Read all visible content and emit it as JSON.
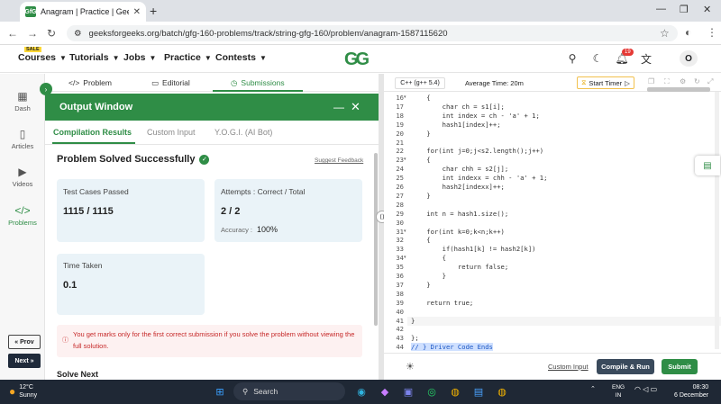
{
  "browser": {
    "tab_title": "Anagram | Practice | GeeksforG",
    "favicon": "GfG",
    "url": "geeksforgeeks.org/batch/gfg-160-problems/track/string-gfg-160/problem/anagram-1587115620"
  },
  "site_header": {
    "sale_badge": "SALE",
    "menus": [
      "Courses",
      "Tutorials",
      "Jobs",
      "Practice",
      "Contests"
    ],
    "logo": "GG",
    "notification_count": "19",
    "avatar_letter": "O"
  },
  "left_rail": {
    "items": [
      {
        "label": "Dash",
        "icon": "dashboard-icon"
      },
      {
        "label": "Articles",
        "icon": "articles-icon"
      },
      {
        "label": "Videos",
        "icon": "videos-icon"
      },
      {
        "label": "Problems",
        "icon": "code-icon"
      }
    ],
    "prev_label": "« Prov",
    "next_label": "Next »"
  },
  "problem_tabs": {
    "problem": "Problem",
    "editorial": "Editorial",
    "submissions": "Submissions"
  },
  "output_window": {
    "title": "Output Window",
    "tabs": [
      "Compilation Results",
      "Custom Input",
      "Y.O.G.I. (AI Bot)"
    ],
    "status": "Problem Solved Successfully",
    "suggest_feedback": "Suggest Feedback",
    "test_cases_label": "Test Cases Passed",
    "test_cases_value": "1115 / 1115",
    "attempts_label": "Attempts : Correct / Total",
    "attempts_value": "2 / 2",
    "accuracy_label": "Accuracy :",
    "accuracy_value": "100%",
    "time_label": "Time Taken",
    "time_value": "0.1",
    "warning": "You get marks only for the first correct submission if you solve the problem without viewing the full solution.",
    "solve_next": "Solve Next"
  },
  "editor": {
    "language": "C++ (g++ 5.4)",
    "average_time": "Average Time: 20m",
    "start_timer": "Start Timer",
    "lines": [
      {
        "n": "16",
        "fold": true,
        "text": "    {"
      },
      {
        "n": "17",
        "text": "        char ch = s1[i];"
      },
      {
        "n": "18",
        "text": "        int index = ch - 'a' + 1;"
      },
      {
        "n": "19",
        "text": "        hash1[index]++;"
      },
      {
        "n": "20",
        "text": "    }"
      },
      {
        "n": "21",
        "text": ""
      },
      {
        "n": "22",
        "text": "    for(int j=0;j<s2.length();j++)"
      },
      {
        "n": "23",
        "fold": true,
        "text": "    {"
      },
      {
        "n": "24",
        "text": "        char chh = s2[j];"
      },
      {
        "n": "25",
        "text": "        int indexx = chh - 'a' + 1;"
      },
      {
        "n": "26",
        "text": "        hash2[indexx]++;"
      },
      {
        "n": "27",
        "text": "    }"
      },
      {
        "n": "28",
        "text": ""
      },
      {
        "n": "29",
        "text": "    int n = hash1.size();"
      },
      {
        "n": "30",
        "text": ""
      },
      {
        "n": "31",
        "fold": true,
        "text": "    for(int k=0;k<n;k++)"
      },
      {
        "n": "32",
        "text": "    {"
      },
      {
        "n": "33",
        "text": "        if(hash1[k] != hash2[k])"
      },
      {
        "n": "34",
        "fold": true,
        "text": "        {"
      },
      {
        "n": "35",
        "text": "            return false;"
      },
      {
        "n": "36",
        "text": "        }"
      },
      {
        "n": "37",
        "text": "    }"
      },
      {
        "n": "38",
        "text": ""
      },
      {
        "n": "39",
        "text": "    return true;"
      },
      {
        "n": "40",
        "text": ""
      },
      {
        "n": "41",
        "text": "}"
      },
      {
        "n": "42",
        "text": ""
      },
      {
        "n": "43",
        "text": "};"
      },
      {
        "n": "44",
        "text": "// } Driver Code Ends"
      }
    ],
    "custom_input": "Custom Input",
    "compile_run": "Compile & Run",
    "submit": "Submit"
  },
  "taskbar": {
    "temperature": "12°C",
    "weather": "Sunny",
    "search_placeholder": "Search",
    "lang_line1": "ENG",
    "lang_line2": "IN",
    "time": "08:30",
    "date": "6 December"
  },
  "colors": {
    "brand": "#2f8d46",
    "warning_text": "#c62828"
  }
}
